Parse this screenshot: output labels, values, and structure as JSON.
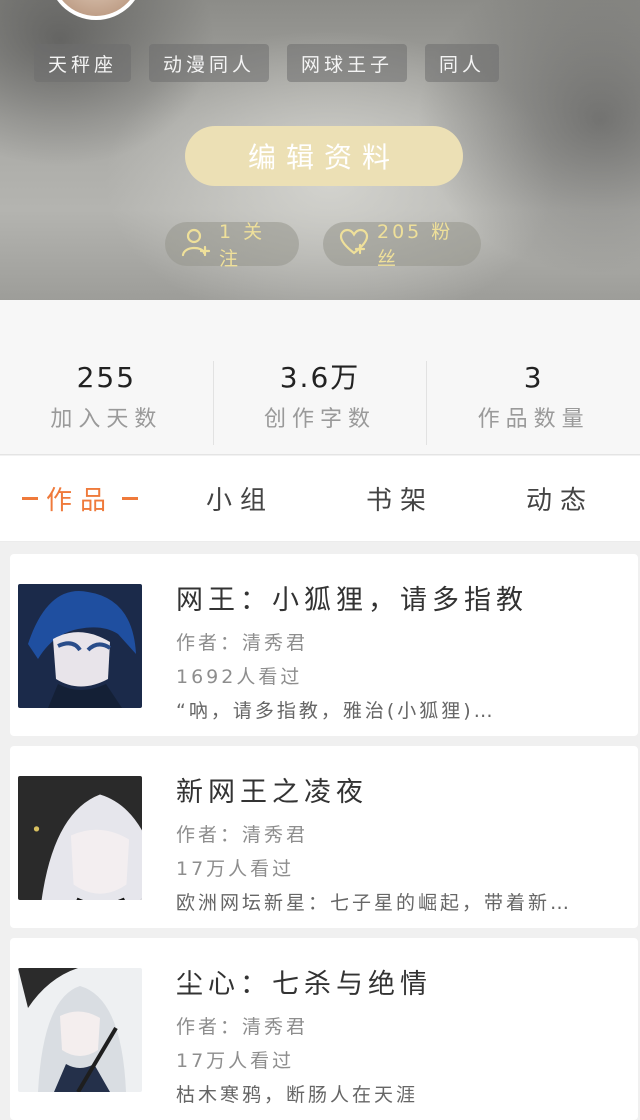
{
  "profile": {
    "tags": [
      "天秤座",
      "动漫同人",
      "网球王子",
      "同人"
    ],
    "edit_button": "编辑资料",
    "follow_text": "1 关注",
    "fans_text": "205 粉丝"
  },
  "stats": [
    {
      "value": "255",
      "label": "加入天数"
    },
    {
      "value": "3.6万",
      "label": "创作字数"
    },
    {
      "value": "3",
      "label": "作品数量"
    }
  ],
  "tabs": [
    {
      "label": "作品",
      "active": true
    },
    {
      "label": "小组",
      "active": false
    },
    {
      "label": "书架",
      "active": false
    },
    {
      "label": "动态",
      "active": false
    }
  ],
  "works": [
    {
      "title": "网王：小狐狸，请多指教",
      "author": "作者：清秀君",
      "views": "1692人看过",
      "desc": "“吶，请多指教，雅治(小狐狸)…"
    },
    {
      "title": "新网王之凌夜",
      "author": "作者：清秀君",
      "views": "17万人看过",
      "desc": "欧洲网坛新星：七子星的崛起，带着新…"
    },
    {
      "title": "尘心：七杀与绝情",
      "author": "作者：清秀君",
      "views": "17万人看过",
      "desc": "枯木寒鸦，断肠人在天涯"
    }
  ],
  "colors": {
    "accent": "#ef7a3b",
    "edit_button_bg": "#ece0b5",
    "pill_text": "#efe09a"
  }
}
